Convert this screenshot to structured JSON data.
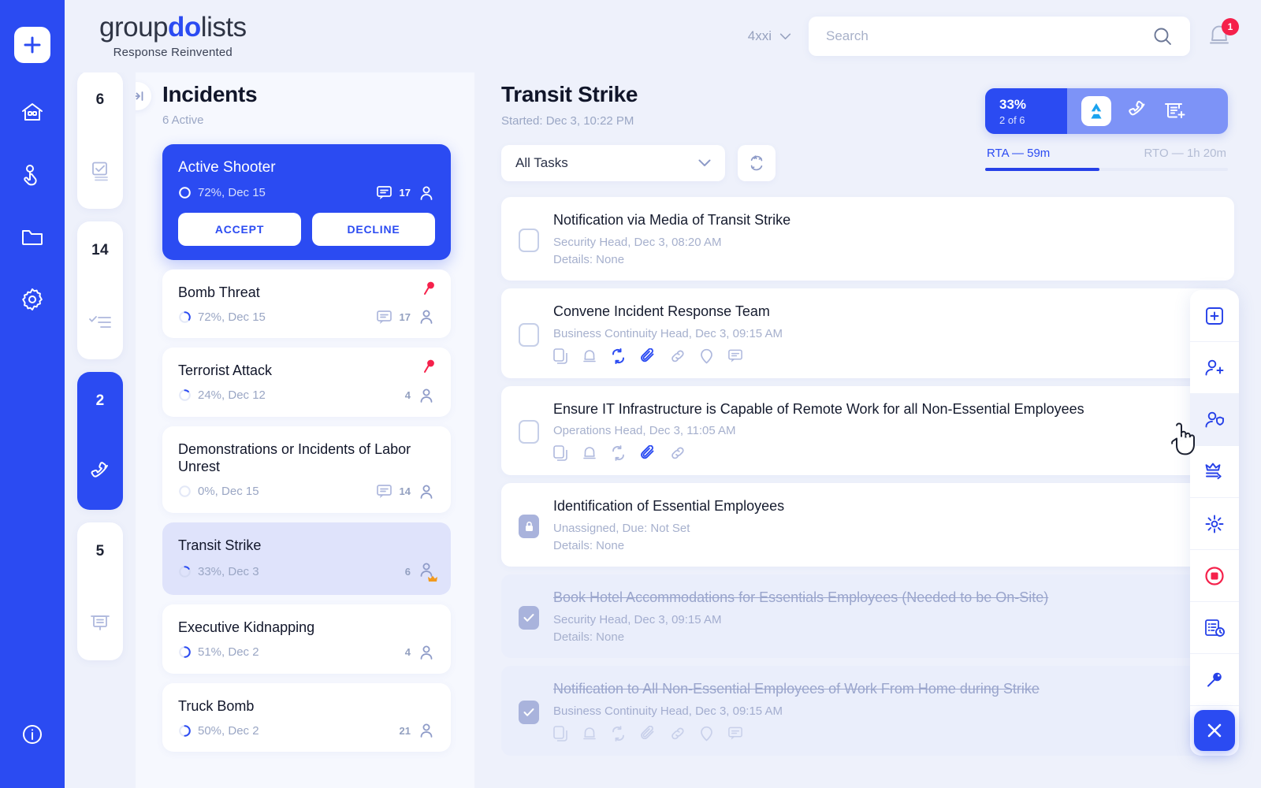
{
  "brand": {
    "name_plain_1": "group",
    "name_bold": "do",
    "name_plain_2": "lists",
    "tagline": "Response Reinvented"
  },
  "topbar": {
    "account": "4xxi",
    "search_placeholder": "Search",
    "notification_count": "1",
    "icons": {
      "chevron": "chevron-down-icon",
      "search": "search-icon",
      "bell": "bell-icon"
    }
  },
  "rail": {
    "add_label": "+",
    "items": [
      {
        "name": "home-icon"
      },
      {
        "name": "tap-hand-icon"
      },
      {
        "name": "folder-icon"
      },
      {
        "name": "gear-icon"
      }
    ],
    "info": "i"
  },
  "badges": [
    {
      "count": "6",
      "icon": "checkbox-stack-icon",
      "active": false
    },
    {
      "count": "14",
      "icon": "checklist-icon",
      "active": false
    },
    {
      "count": "2",
      "icon": "phone-icon",
      "active": true
    },
    {
      "count": "5",
      "icon": "presentation-icon",
      "active": false
    }
  ],
  "incidents": {
    "title": "Incidents",
    "subtitle": "6 Active",
    "collapse_icon": "collapse-panel-icon",
    "featured": {
      "title": "Active Shooter",
      "meta": "72%, Dec 15",
      "comment_icon": "comment-icon",
      "people_count": "17",
      "accept_label": "ACCEPT",
      "decline_label": "DECLINE"
    },
    "items": [
      {
        "title": "Bomb Threat",
        "meta": "72%, Dec 15",
        "people": "17",
        "comments": true,
        "pin": true,
        "selected": false,
        "crown": false
      },
      {
        "title": "Terrorist Attack",
        "meta": "24%, Dec 12",
        "people": "4",
        "comments": false,
        "pin": true,
        "selected": false,
        "crown": false
      },
      {
        "title": "Demonstrations or Incidents of Labor Unrest",
        "meta": "0%, Dec 15",
        "people": "14",
        "comments": true,
        "pin": false,
        "selected": false,
        "crown": false
      },
      {
        "title": "Transit Strike",
        "meta": "33%, Dec 3",
        "people": "6",
        "comments": false,
        "pin": false,
        "selected": true,
        "crown": true
      },
      {
        "title": "Executive Kidnapping",
        "meta": "51%, Dec 2",
        "people": "4",
        "comments": false,
        "pin": false,
        "selected": false,
        "crown": false
      },
      {
        "title": "Truck Bomb",
        "meta": "50%, Dec 2",
        "people": "21",
        "comments": false,
        "pin": false,
        "selected": false,
        "crown": false
      }
    ]
  },
  "main": {
    "title": "Transit Strike",
    "started": "Started: Dec 3, 10:22 PM",
    "filter_value": "All Tasks",
    "sort_icon": "auto-sort-icon",
    "progress": {
      "percent": "33%",
      "count": "2 of 6",
      "logo_icon": "groupdolists-logo-icon",
      "call_icon": "phone-icon",
      "report_icon": "new-report-icon",
      "rta_label": "RTA — 59m",
      "rto_label": "RTO — 1h 20m",
      "bar_fill_percent": 47
    },
    "tasks": [
      {
        "title": "Notification via Media of Transit Strike",
        "meta": "Security Head, Dec 3, 08:20 AM",
        "details": "Details: None",
        "state": "open",
        "icons": []
      },
      {
        "title": "Convene Incident Response Team",
        "meta": "Business Continuity Head, Dec 3, 09:15 AM",
        "details": "",
        "state": "open",
        "icons": [
          "copy-icon",
          "bell-icon",
          "recurring-icon",
          "attachment-icon",
          "link-icon",
          "location-icon",
          "comment-icon"
        ],
        "active_icons": [
          "recurring-icon",
          "attachment-icon"
        ]
      },
      {
        "title": "Ensure IT Infrastructure is Capable of Remote Work for all Non-Essential Employees",
        "meta": "Operations Head, Dec 3, 11:05 AM",
        "details": "",
        "state": "open",
        "icons": [
          "copy-icon",
          "bell-icon",
          "recurring-icon",
          "attachment-icon",
          "link-icon"
        ],
        "active_icons": [
          "attachment-icon"
        ]
      },
      {
        "title": "Identification of Essential Employees",
        "meta": "Unassigned, Due: Not Set",
        "details": "Details: None",
        "state": "locked",
        "icons": []
      },
      {
        "title": "Book Hotel Accommodations for Essentials Employees (Needed to be On-Site)",
        "meta": "Security Head, Dec 3, 09:15 AM",
        "details": "Details: None",
        "state": "done",
        "icons": []
      },
      {
        "title": "Notification to All Non-Essential Employees of Work From Home during Strike",
        "meta": "Business Continuity Head, Dec 3, 09:15 AM",
        "details": "",
        "state": "done",
        "icons": [
          "copy-icon",
          "bell-icon",
          "recurring-icon",
          "attachment-icon",
          "link-icon",
          "location-icon",
          "comment-icon"
        ],
        "active_icons": []
      }
    ]
  },
  "fab_toolbar": [
    {
      "icon": "add-task-icon",
      "highlight": false
    },
    {
      "icon": "add-user-icon",
      "highlight": false
    },
    {
      "icon": "user-shield-icon",
      "highlight": true
    },
    {
      "icon": "transfer-lead-icon",
      "highlight": false
    },
    {
      "icon": "focus-target-icon",
      "highlight": false
    },
    {
      "icon": "stop-record-icon",
      "highlight": false
    },
    {
      "icon": "activity-log-icon",
      "highlight": false
    },
    {
      "icon": "key-icon",
      "highlight": false
    }
  ],
  "fab_close_icon": "close-icon",
  "colors": {
    "brand_blue": "#2b4bf2",
    "page_bg": "#eef1fb",
    "panel_bg": "#f6f8fe",
    "selected_card": "#dfe3fb",
    "danger_red": "#f5214b",
    "muted_text": "#9aa6c4"
  }
}
